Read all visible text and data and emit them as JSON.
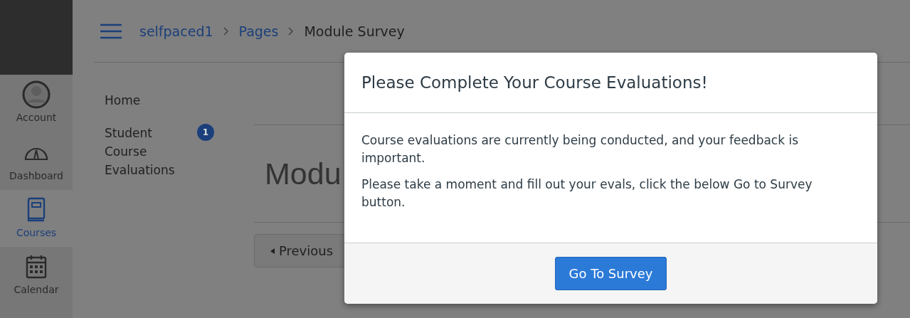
{
  "global_nav": [
    {
      "kind": "account",
      "label": "Account",
      "selected": false
    },
    {
      "kind": "dashboard",
      "label": "Dashboard",
      "selected": false
    },
    {
      "kind": "courses",
      "label": "Courses",
      "selected": true
    },
    {
      "kind": "calendar",
      "label": "Calendar",
      "selected": false
    }
  ],
  "breadcrumbs": [
    {
      "label": "selfpaced1",
      "link": true
    },
    {
      "label": "Pages",
      "link": true
    },
    {
      "label": "Module Survey",
      "link": false
    }
  ],
  "course_nav": [
    {
      "label": "Home"
    },
    {
      "label": "Student Course Evaluations",
      "badge": "1"
    }
  ],
  "page": {
    "title": "Modu",
    "previous_button": "Previous"
  },
  "modal": {
    "title": "Please Complete Your Course Evaluations!",
    "paragraphs": [
      "Course evaluations are currently being conducted, and your feedback is important.",
      "Please take a moment and fill out your evals, click the below Go to Survey button."
    ],
    "button": "Go To Survey"
  }
}
